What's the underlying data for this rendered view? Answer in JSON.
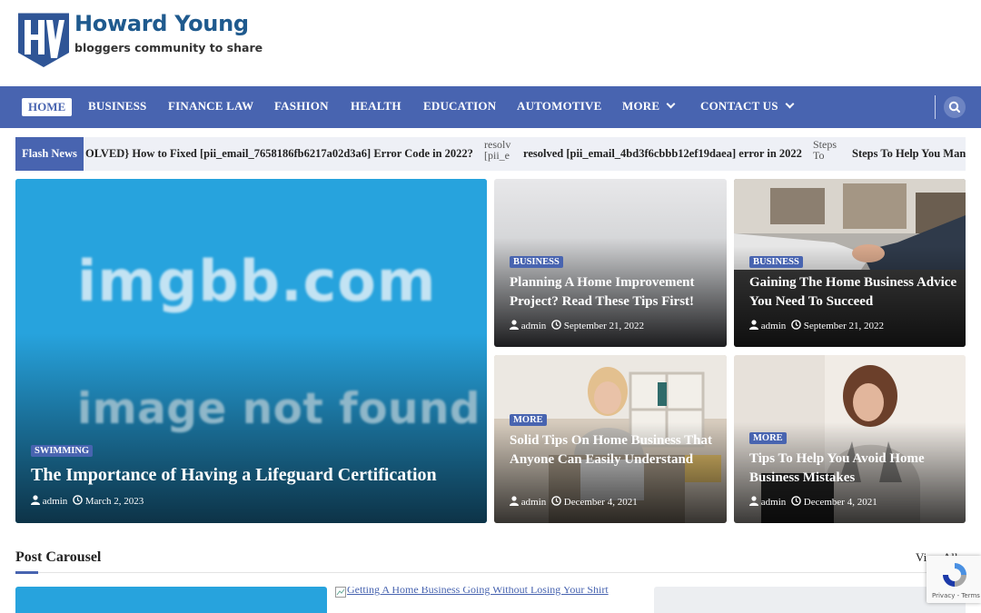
{
  "site": {
    "title": "Howard Young",
    "tagline": "bloggers community to share",
    "logo_icon": "hy-shield-logo"
  },
  "nav": {
    "items": [
      {
        "label": "HOME",
        "active": true
      },
      {
        "label": "BUSINESS"
      },
      {
        "label": "FINANCE LAW"
      },
      {
        "label": "FASHION"
      },
      {
        "label": "HEALTH"
      },
      {
        "label": "EDUCATION"
      },
      {
        "label": "AUTOMOTIVE"
      },
      {
        "label": "MORE",
        "dropdown": true
      },
      {
        "label": "CONTACT US",
        "dropdown": true
      }
    ],
    "search_icon": "search-icon"
  },
  "flash_news": {
    "label": "Flash News",
    "items": [
      {
        "text": "OLVED} How to Fixed [pii_email_7658186fb6217a02d3a6] Error Code in 2022?"
      },
      {
        "img_alt": "resolv [pii_e",
        "text": "resolved [pii_email_4bd3f6cbbb12ef19daea] error in 2022"
      },
      {
        "img_alt": "Steps To",
        "text": "Steps To Help You Mana"
      }
    ]
  },
  "featured": {
    "image_text_1": "imgbb.com",
    "image_text_2": "image not found",
    "category": "SWIMMING",
    "title": "The Importance of Having a Lifeguard Certification",
    "author": "admin",
    "date": "March 2, 2023"
  },
  "grid": [
    {
      "category": "BUSINESS",
      "title": "Planning A Home Improvement Project? Read These Tips First!",
      "author": "admin",
      "date": "September 21, 2022"
    },
    {
      "category": "BUSINESS",
      "title": "Gaining The Home Business Advice You Need To Succeed",
      "author": "admin",
      "date": "September 21, 2022"
    },
    {
      "category": "MORE",
      "title": "Solid Tips On Home Business That Anyone Can Easily Understand",
      "author": "admin",
      "date": "December 4, 2021"
    },
    {
      "category": "MORE",
      "title": "Tips To Help You Avoid Home Business Mistakes",
      "author": "admin",
      "date": "December 4, 2021"
    }
  ],
  "section": {
    "title": "Post Carousel",
    "view_all": "View All"
  },
  "carousel": {
    "item2_alt": "Getting A Home Business Going Without Losing Your Shirt"
  },
  "recaptcha": {
    "footer": "Privacy - Terms"
  },
  "colors": {
    "primary": "#4864b0",
    "featured_bg": "#27a3dd"
  }
}
